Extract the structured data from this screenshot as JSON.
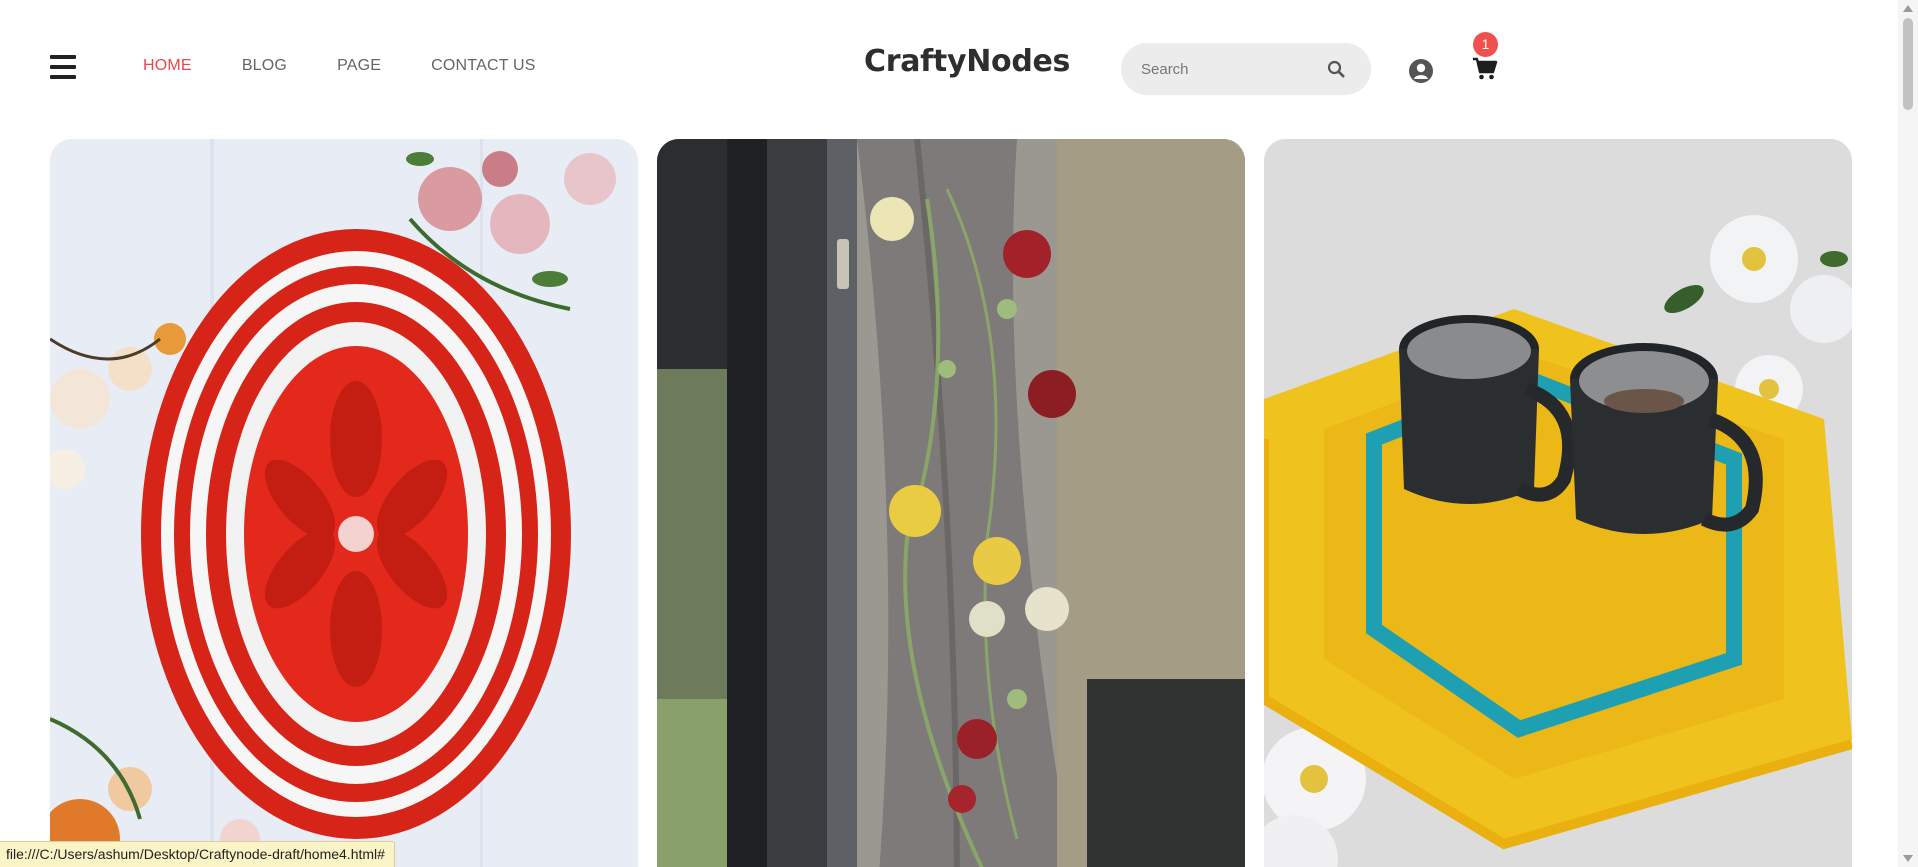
{
  "brand": {
    "name": "CraftyNodes"
  },
  "nav": {
    "items": [
      {
        "label": "HOME",
        "active": true
      },
      {
        "label": "BLOG",
        "active": false
      },
      {
        "label": "PAGE",
        "active": false
      },
      {
        "label": "CONTACT US",
        "active": false
      }
    ]
  },
  "search": {
    "placeholder": "Search",
    "value": ""
  },
  "cart": {
    "count": "1"
  },
  "icons": {
    "menu": "hamburger-menu-icon",
    "search": "search-icon",
    "user": "user-icon",
    "cart": "shopping-cart-icon"
  },
  "colors": {
    "accent": "#e8474f",
    "badge": "#f0504e",
    "search_bg": "#ececec"
  },
  "gallery": [
    {
      "subject": "red and white crochet doily with flowers"
    },
    {
      "subject": "crochet flower garland on curtain by window"
    },
    {
      "subject": "yellow crochet mat with two mugs and white flowers"
    }
  ],
  "status_bar": {
    "url": "file:///C:/Users/ashum/Desktop/Craftynode-draft/home4.html#"
  }
}
